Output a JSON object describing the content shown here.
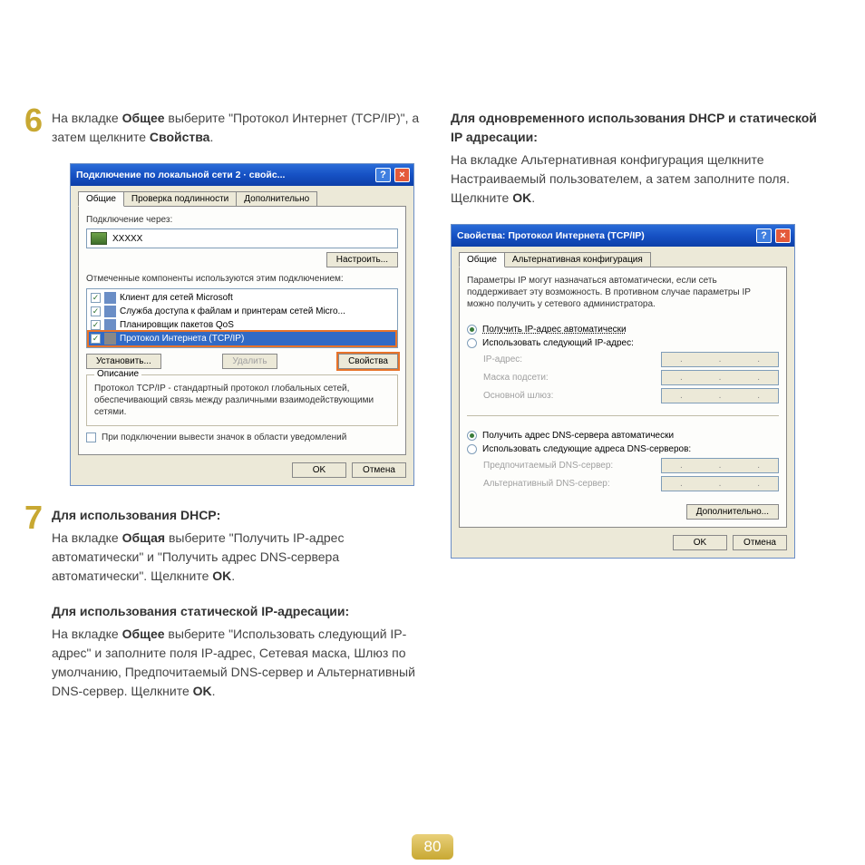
{
  "page_number": "80",
  "left": {
    "step6": {
      "num": "6",
      "text_before": "На вкладке ",
      "bold1": "Общее",
      "text_mid": " выберите \"Протокол Интернет (TCP/IP)\", а затем щелкните ",
      "bold2": "Свойства",
      "text_after": "."
    },
    "dialog1": {
      "title": "Подключение по локальной сети 2 · свойс...",
      "tabs": {
        "t1": "Общие",
        "t2": "Проверка подлинности",
        "t3": "Дополнительно"
      },
      "connect_via": "Подключение через:",
      "adapter": "XXXXX",
      "configure": "Настроить...",
      "components_label": "Отмеченные компоненты используются этим подключением:",
      "items": {
        "i1": "Клиент для сетей Microsoft",
        "i2": "Служба доступа к файлам и принтерам сетей Micro...",
        "i3": "Планировщик пакетов QoS",
        "i4": "Протокол Интернета (TCP/IP)"
      },
      "install": "Установить...",
      "remove": "Удалить",
      "properties": "Свойства",
      "desc_title": "Описание",
      "desc_body": "Протокол TCP/IP - стандартный протокол глобальных сетей, обеспечивающий связь между различными взаимодействующими сетями.",
      "notify": "При подключении вывести значок в области уведомлений",
      "ok": "OK",
      "cancel": "Отмена"
    },
    "step7": {
      "num": "7",
      "h1": "Для использования DHCP:",
      "p1_a": "На вкладке ",
      "p1_b": "Общая",
      "p1_c": " выберите \"Получить IP-адрес автоматически\" и \"Получить адрес DNS-сервера автоматически\". Щелкните ",
      "p1_d": "OK",
      "p1_e": ".",
      "h2": "Для использования статической IP-адресации:",
      "p2_a": "На вкладке ",
      "p2_b": "Общее",
      "p2_c": " выберите \"Использовать следующий IP-адрес\" и заполните поля IP-адрес, Сетевая маска, Шлюз по умолчанию, Предпочитаемый DNS-сервер и Альтернативный DNS-сервер. Щелкните ",
      "p2_d": "OK",
      "p2_e": "."
    }
  },
  "right": {
    "h": "Для одновременного использования DHCP и статической IP адресации:",
    "p_a": "На вкладке Альтернативная конфигурация щелкните Настраиваемый пользователем, а затем заполните поля. Щелкните ",
    "p_b": "OK",
    "p_c": ".",
    "dialog2": {
      "title": "Свойства: Протокол Интернета (TCP/IP)",
      "tabs": {
        "t1": "Общие",
        "t2": "Альтернативная конфигурация"
      },
      "intro": "Параметры IP могут назначаться автоматически, если сеть поддерживает эту возможность. В противном случае параметры IP можно получить у сетевого администратора.",
      "r1": "Получить IP-адрес автоматически",
      "r2": "Использовать следующий IP-адрес:",
      "ip_label": "IP-адрес:",
      "mask_label": "Маска подсети:",
      "gw_label": "Основной шлюз:",
      "r3": "Получить адрес DNS-сервера автоматически",
      "r4": "Использовать следующие адреса DNS-серверов:",
      "dns1": "Предпочитаемый DNS-сервер:",
      "dns2": "Альтернативный DNS-сервер:",
      "advanced": "Дополнительно...",
      "ok": "OK",
      "cancel": "Отмена"
    }
  }
}
